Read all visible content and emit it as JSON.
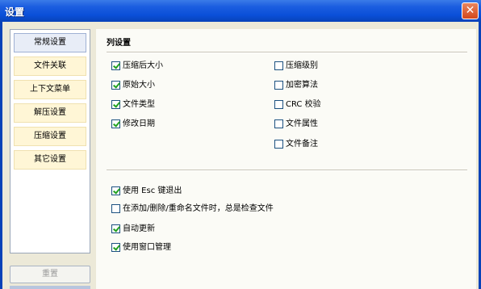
{
  "window": {
    "title": "设置",
    "close_symbol": "✕"
  },
  "sidebar": {
    "items": [
      {
        "label": "常规设置",
        "active": true
      },
      {
        "label": "文件关联",
        "active": false
      },
      {
        "label": "上下文菜单",
        "active": false
      },
      {
        "label": "解压设置",
        "active": false
      },
      {
        "label": "压缩设置",
        "active": false
      },
      {
        "label": "其它设置",
        "active": false
      }
    ],
    "reset_label": "重置"
  },
  "columns": {
    "title": "列设置",
    "left": [
      {
        "label": "压缩后大小",
        "checked": true
      },
      {
        "label": "原始大小",
        "checked": true
      },
      {
        "label": "文件类型",
        "checked": true
      },
      {
        "label": "修改日期",
        "checked": true
      }
    ],
    "right": [
      {
        "label": "压缩级别",
        "checked": false
      },
      {
        "label": "加密算法",
        "checked": false
      },
      {
        "label": "CRC 校验",
        "checked": false
      },
      {
        "label": "文件属性",
        "checked": false
      },
      {
        "label": "文件备注",
        "checked": false
      }
    ]
  },
  "options": [
    {
      "label": "使用 Esc 键退出",
      "checked": true
    },
    {
      "label": "在添加/删除/重命名文件时，总是检查文件",
      "checked": false
    },
    {
      "label": "自动更新",
      "checked": true
    },
    {
      "label": "使用窗口管理",
      "checked": true
    }
  ],
  "colors": {
    "titlebar": "#0a4fd8",
    "frame": "#0842b8",
    "nav_item_bg": "#fff6d6",
    "nav_active_bg": "#e8edf7",
    "check_mark": "#21a121"
  }
}
